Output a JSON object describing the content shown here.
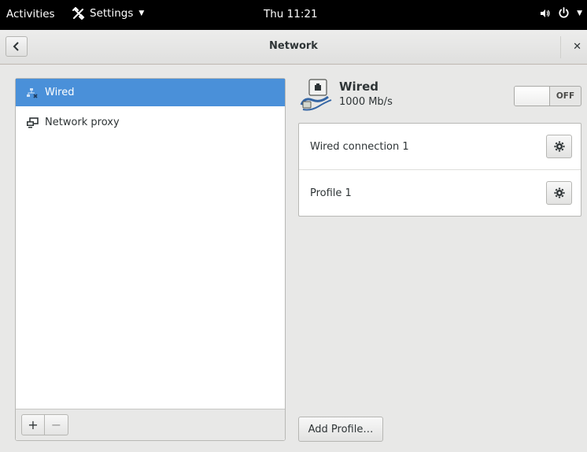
{
  "topbar": {
    "activities": "Activities",
    "app_menu": "Settings",
    "clock": "Thu 11:21"
  },
  "window": {
    "title": "Network"
  },
  "sidebar": {
    "items": [
      {
        "label": "Wired",
        "icon": "wired-network-icon",
        "selected": true
      },
      {
        "label": "Network proxy",
        "icon": "network-proxy-icon",
        "selected": false
      }
    ],
    "add_button": "+",
    "remove_button": "−"
  },
  "device": {
    "name": "Wired",
    "speed": "1000 Mb/s",
    "switch_state": "OFF"
  },
  "profiles": [
    {
      "name": "Wired connection 1"
    },
    {
      "name": "Profile 1"
    }
  ],
  "add_profile_label": "Add Profile…",
  "colors": {
    "accent": "#4a90d9",
    "topbar_bg": "#000000",
    "window_bg": "#e8e8e7"
  }
}
